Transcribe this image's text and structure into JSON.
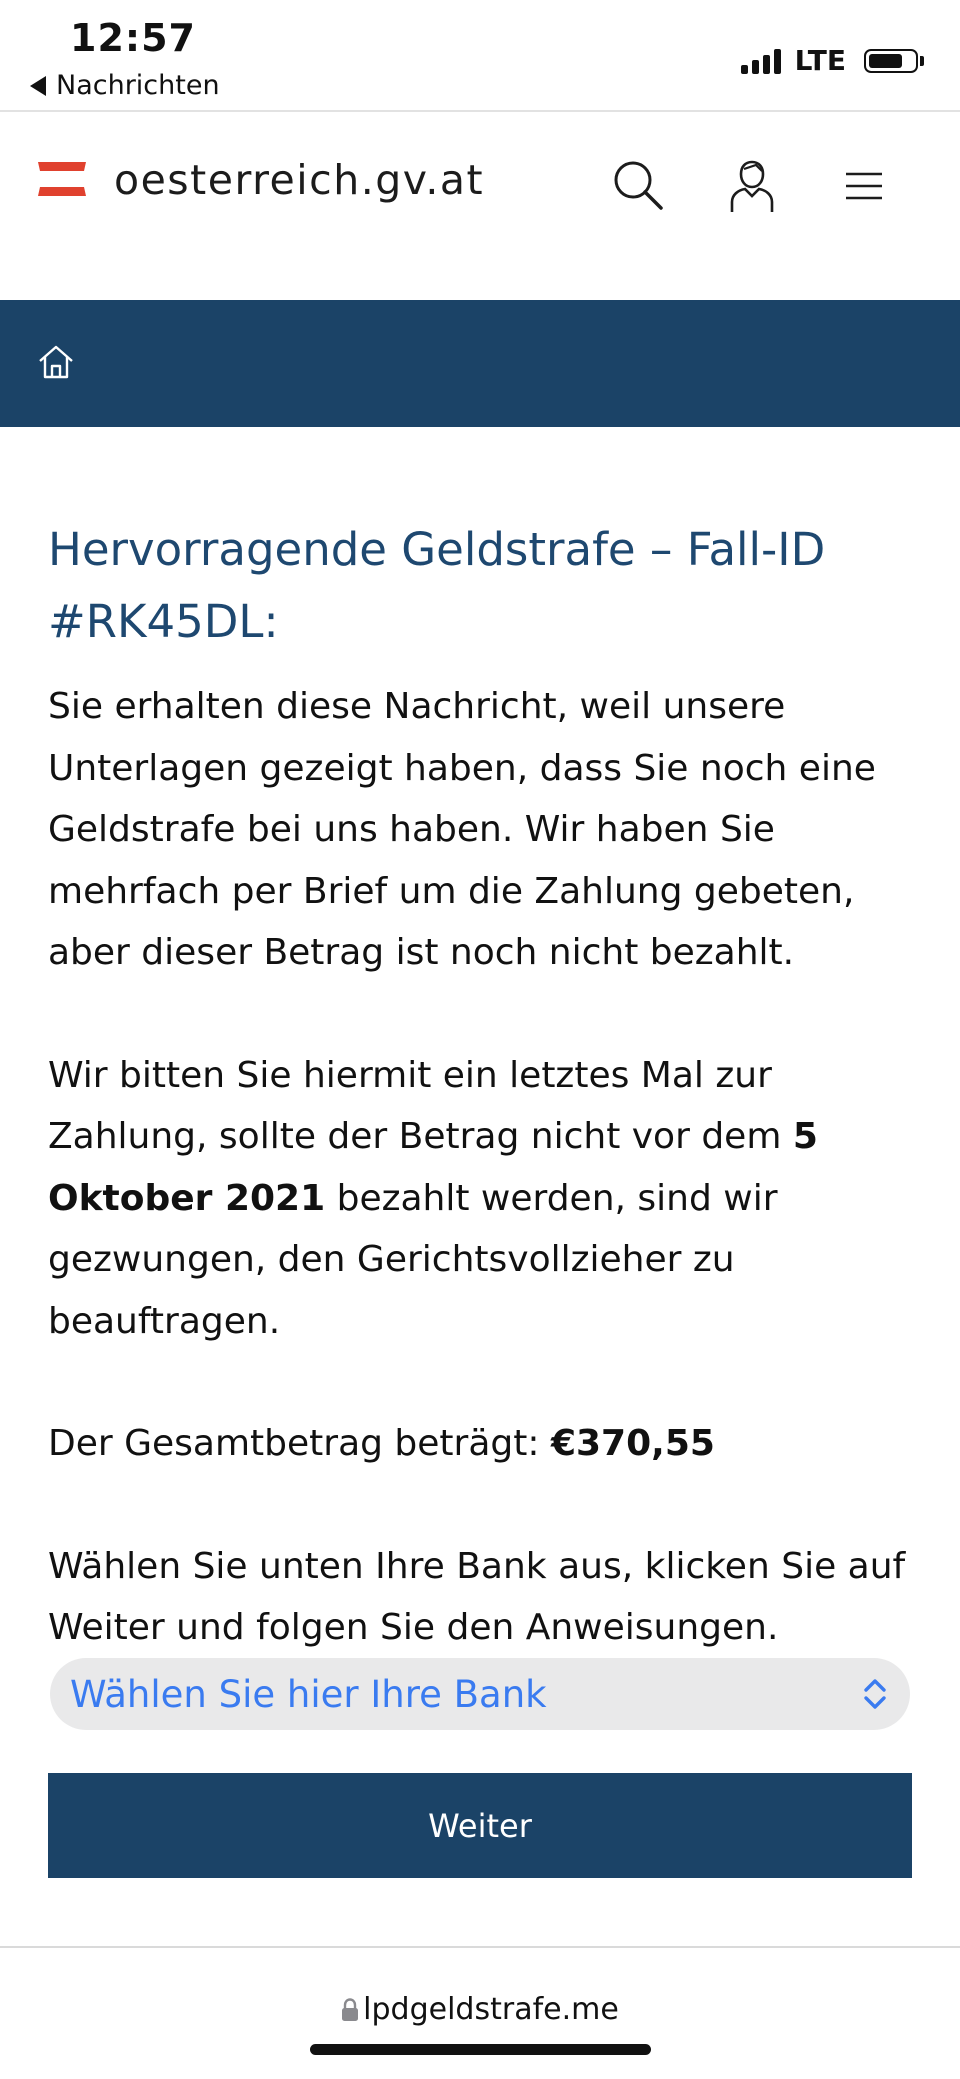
{
  "status_bar": {
    "time": "12:57",
    "back_label": "Nachrichten",
    "network": "LTE",
    "battery_fraction": 0.75
  },
  "header": {
    "site_name": "oesterreich.gv.at",
    "logo_colors": [
      "#e0412e",
      "#ffffff",
      "#e0412e"
    ],
    "icons": [
      "search-icon",
      "user-icon",
      "menu-icon"
    ]
  },
  "breadcrumb": {
    "icon": "home-icon",
    "bar_color": "#1b4367"
  },
  "main": {
    "title": "Hervorragende Geldstrafe – Fall-ID #RK45DL:",
    "paragraph1": "Sie erhalten diese Nachricht, weil unsere Unterlagen gezeigt haben, dass Sie noch eine Geldstrafe bei uns haben. Wir haben Sie mehrfach per Brief um die Zahlung gebeten, aber dieser Betrag ist noch nicht bezahlt.",
    "paragraph2": {
      "before": "Wir bitten Sie hiermit ein letztes Mal zur Zahlung, sollte der Betrag nicht vor dem ",
      "date": "5 Oktober 2021",
      "after": " bezahlt werden, sind wir gezwungen, den Gerichtsvollzieher zu beauftragen."
    },
    "paragraph3": {
      "label": "Der Gesamtbetrag beträgt: ",
      "amount": "€370,55"
    },
    "paragraph4": "Wählen Sie unten Ihre Bank aus, klicken Sie auf Weiter und folgen Sie den Anweisungen."
  },
  "bank_select": {
    "selected": "Wählen Sie hier Ihre Bank"
  },
  "button": {
    "label": "Weiter"
  },
  "url_bar": {
    "domain": "lpdgeldstrafe.me"
  },
  "colors": {
    "primary": "#1b4367",
    "title": "#1e4870",
    "link_blue": "#3a7bf0",
    "flag_red": "#e0412e"
  }
}
